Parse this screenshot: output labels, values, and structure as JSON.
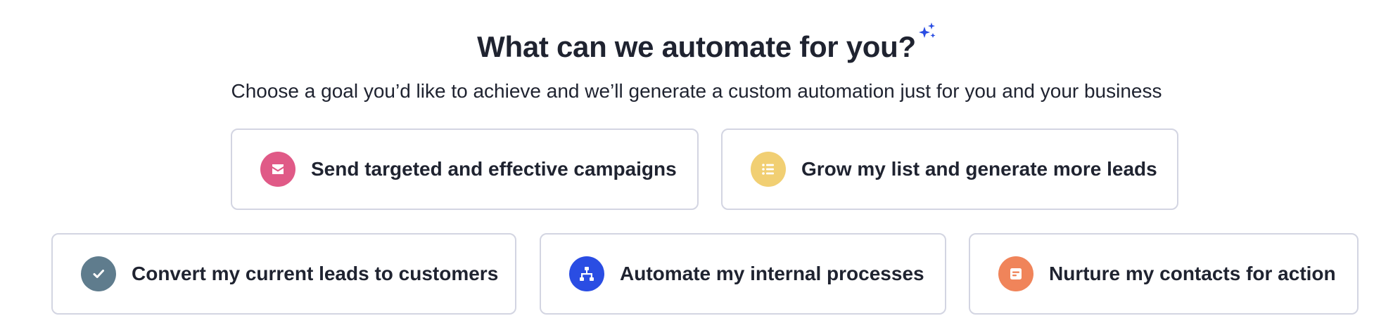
{
  "header": {
    "title": "What can we automate for you?",
    "sparkle_icon": "sparkle-icon",
    "subtitle": "Choose a goal you’d like to achieve and we’ll generate a custom automation just for you and your business"
  },
  "goals": [
    {
      "label": "Send targeted and effective campaigns",
      "icon": "envelope-icon",
      "color": "#e05a87"
    },
    {
      "label": "Grow my list and generate more leads",
      "icon": "list-icon",
      "color": "#f1cf73"
    },
    {
      "label": "Convert my current leads to customers",
      "icon": "check-icon",
      "color": "#5f7c8d"
    },
    {
      "label": "Automate my internal processes",
      "icon": "workflow-icon",
      "color": "#2a4de3"
    },
    {
      "label": "Nurture my contacts for action",
      "icon": "form-icon",
      "color": "#f0845a"
    }
  ],
  "colors": {
    "accent_sparkle": "#2a4de3",
    "text": "#1f2330",
    "card_border": "#d3d5e2"
  }
}
